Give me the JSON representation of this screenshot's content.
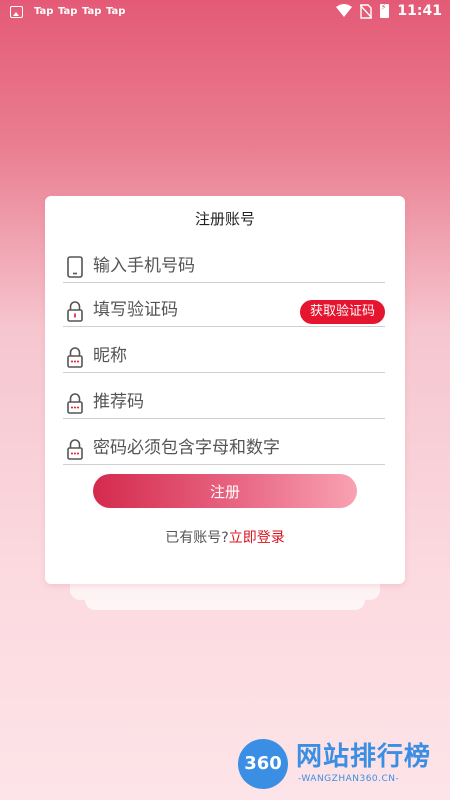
{
  "status_bar": {
    "tap_labels": [
      "Tap",
      "Tap",
      "Tap",
      "Tap"
    ],
    "time": "11:41"
  },
  "card": {
    "title": "注册账号",
    "phone_placeholder": "输入手机号码",
    "code_placeholder": "填写验证码",
    "get_code_label": "获取验证码",
    "nickname_placeholder": "昵称",
    "referral_placeholder": "推荐码",
    "password_placeholder": "密码必须包含字母和数字",
    "register_label": "注册",
    "have_account_text": "已有账号?",
    "login_link": "立即登录"
  },
  "watermark": {
    "number": "360",
    "brand": "网站排行榜",
    "url": "-WANGZHAN360.CN-"
  },
  "colors": {
    "accent_red": "#e5142f",
    "link_red": "#d9141f",
    "gradient_top": "#e45a76",
    "watermark_blue": "#3a8fe4"
  }
}
